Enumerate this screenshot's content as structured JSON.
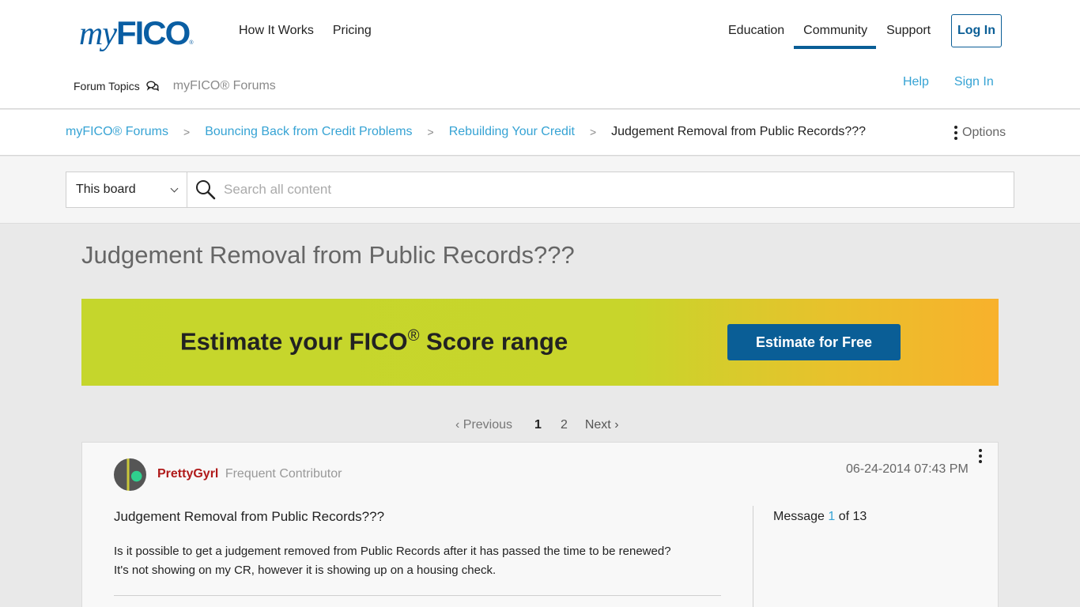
{
  "header": {
    "logo": {
      "my": "my",
      "fico": "FICO",
      "reg": "®"
    },
    "nav_left": [
      "How It Works",
      "Pricing"
    ],
    "nav_right": [
      "Education",
      "Community",
      "Support"
    ],
    "active_nav": "Community",
    "login_label": "Log In",
    "forum_topics_label": "Forum Topics",
    "forums_link": "myFICO® Forums",
    "help_label": "Help",
    "signin_label": "Sign In"
  },
  "breadcrumb": {
    "items": [
      "myFICO® Forums",
      "Bouncing Back from Credit Problems",
      "Rebuilding Your Credit"
    ],
    "separator": ">",
    "current": "Judgement Removal from Public Records???",
    "options_label": "Options"
  },
  "search": {
    "scope": "This board",
    "placeholder": "Search all content"
  },
  "page": {
    "title": "Judgement Removal from Public Records???"
  },
  "banner": {
    "text_before": "Estimate your FICO",
    "sup": "®",
    "text_after": " Score range",
    "button": "Estimate for Free",
    "colors": {
      "start": "#c5d62c",
      "end": "#f8b12c",
      "button": "#0a5e96"
    }
  },
  "pager": {
    "prev": "Previous",
    "pages": [
      "1",
      "2"
    ],
    "current": "1",
    "next": "Next"
  },
  "post": {
    "author": "PrettyGyrl",
    "rank": "Frequent Contributor",
    "date": "06-24-2014 07:43 PM",
    "subject": "Judgement Removal from Public Records???",
    "body_line1": "Is it possible to get a judgement removed from Public Records after it has passed the time to be renewed?",
    "body_line2": "It's not showing on my CR, however it is showing up on a housing check.",
    "message_label": "Message",
    "message_num": "1",
    "message_of": "of 13"
  }
}
